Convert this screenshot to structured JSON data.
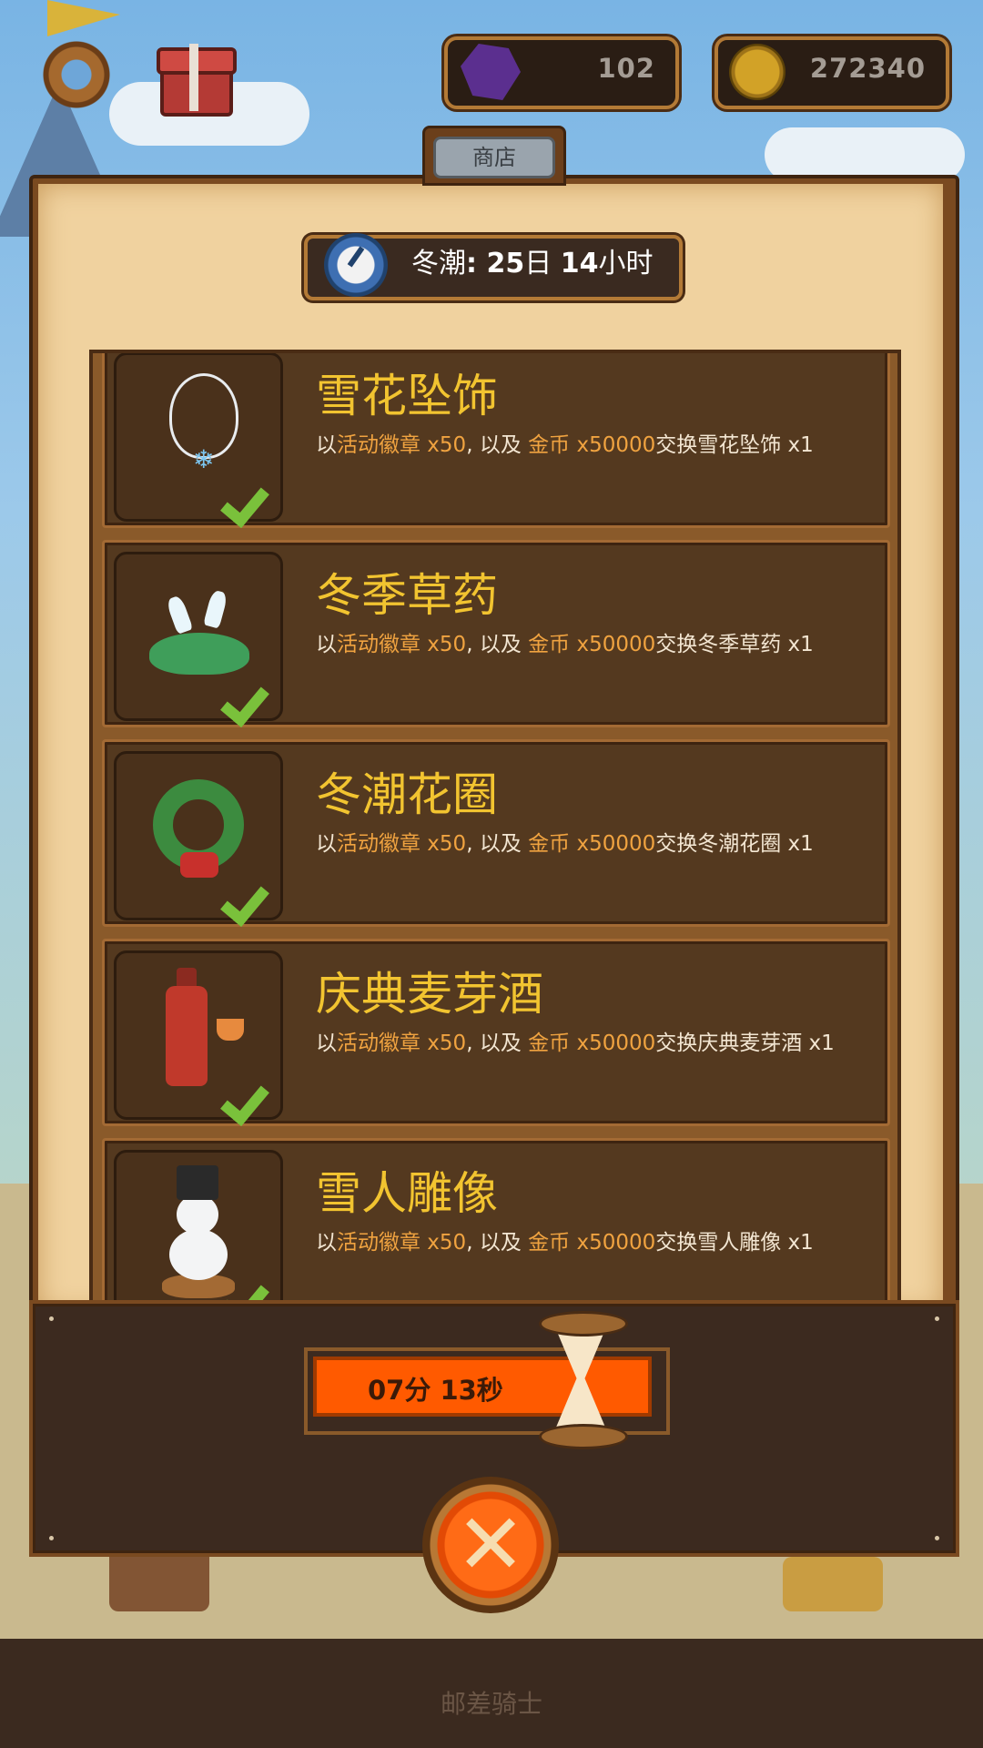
{
  "hud": {
    "gems": "102",
    "coins": "272340"
  },
  "shop": {
    "tab_label": "商店",
    "event_timer": {
      "event_name": "冬潮",
      "days": "25",
      "days_unit": "日",
      "hours": "14",
      "hours_unit": "小时"
    },
    "items": [
      {
        "title": "雪花坠饰",
        "desc_prefix": "以",
        "desc_badge": "活动徽章 x50",
        "desc_mid": ", 以及 ",
        "desc_coin": "金币 x50000",
        "desc_suffix": "交换雪花坠饰 x1",
        "icon": "snowflake-necklace-icon"
      },
      {
        "title": "冬季草药",
        "desc_prefix": "以",
        "desc_badge": "活动徽章 x50",
        "desc_mid": ", 以及 ",
        "desc_coin": "金币 x50000",
        "desc_suffix": "交换冬季草药 x1",
        "icon": "winter-herb-icon"
      },
      {
        "title": "冬潮花圈",
        "desc_prefix": "以",
        "desc_badge": "活动徽章 x50",
        "desc_mid": ", 以及 ",
        "desc_coin": "金币 x50000",
        "desc_suffix": "交换冬潮花圈 x1",
        "icon": "wreath-icon"
      },
      {
        "title": "庆典麦芽酒",
        "desc_prefix": "以",
        "desc_badge": "活动徽章 x50",
        "desc_mid": ", 以及 ",
        "desc_coin": "金币 x50000",
        "desc_suffix": "交换庆典麦芽酒 x1",
        "icon": "ale-bottle-icon"
      },
      {
        "title": "雪人雕像",
        "desc_prefix": "以",
        "desc_badge": "活动徽章 x50",
        "desc_mid": ", 以及 ",
        "desc_coin": "金币 x50000",
        "desc_suffix": "交换雪人雕像 x1",
        "icon": "snowman-statue-icon"
      }
    ],
    "refresh_countdown": "07分 13秒"
  },
  "footer": "邮差骑士",
  "colors": {
    "title_gold": "#f2c430",
    "highlight_orange": "#f0a340",
    "countdown_bar": "#ff5a00",
    "check_green": "#7ac13b"
  }
}
